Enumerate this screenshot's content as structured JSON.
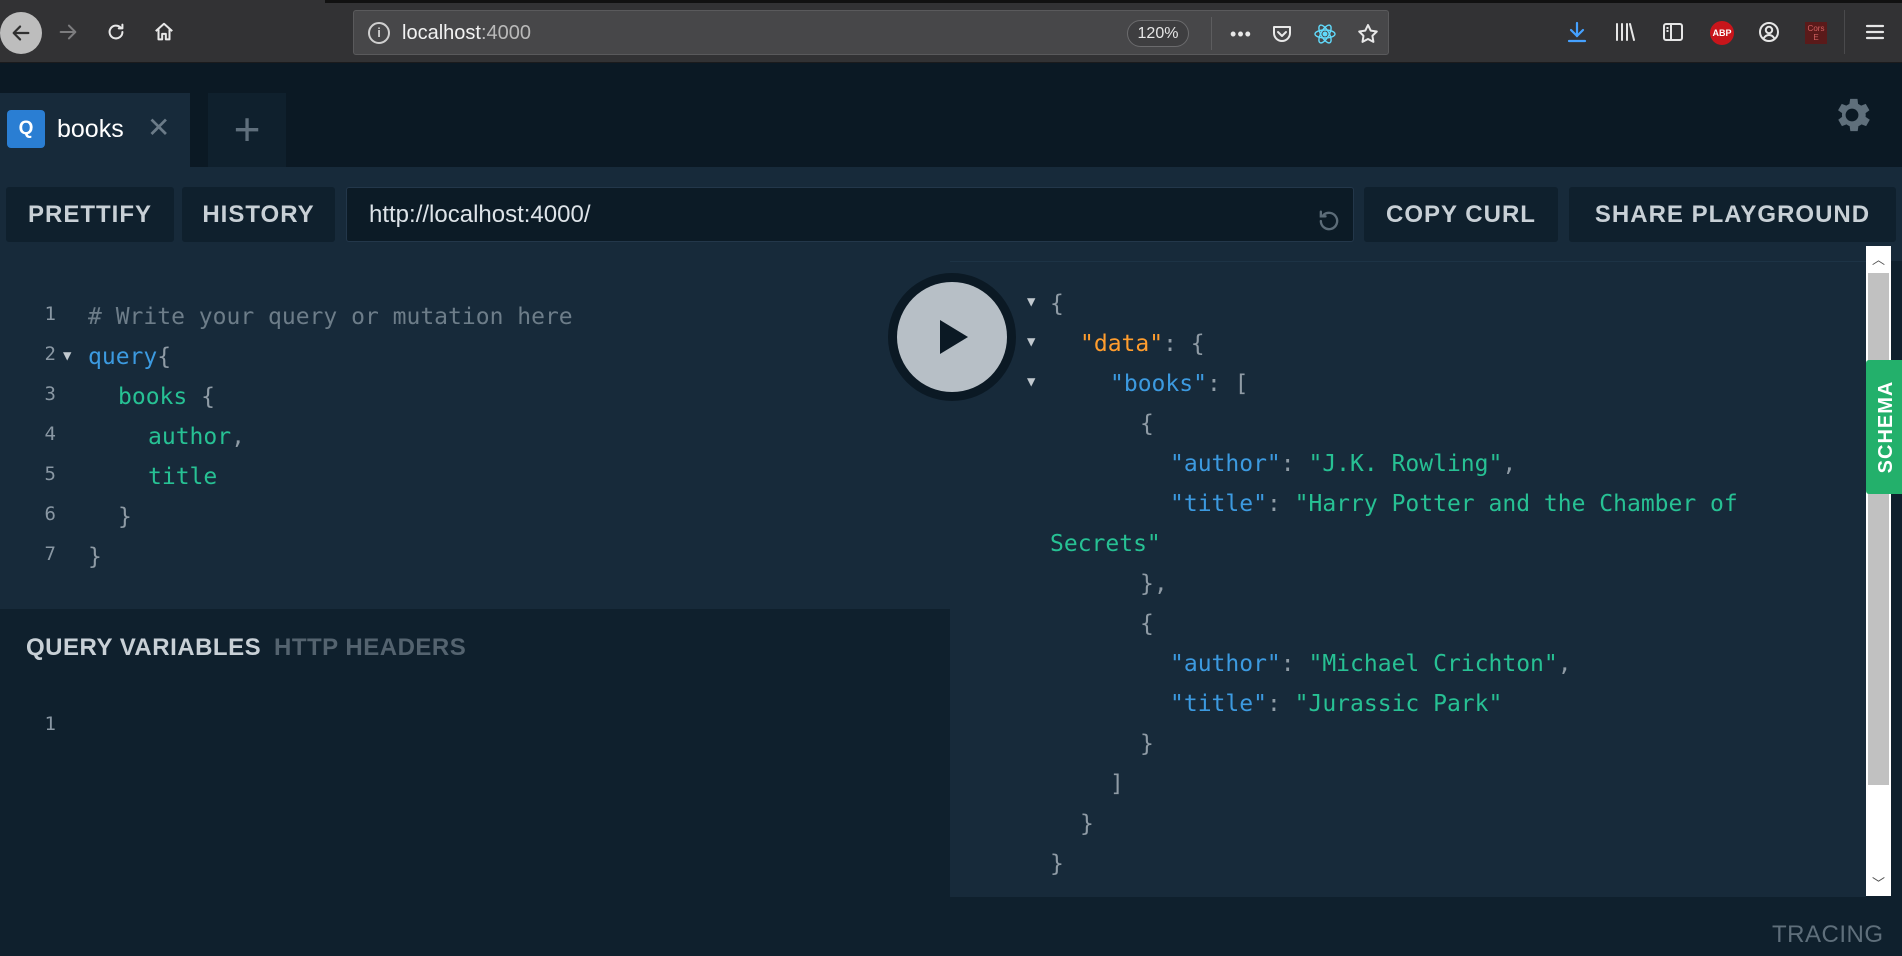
{
  "browser": {
    "url_host": "localhost",
    "url_port": ":4000",
    "zoom": "120%",
    "more_label": "•••"
  },
  "tabs": {
    "active": {
      "badge": "Q",
      "label": "books",
      "close": "✕"
    },
    "add_label": "+"
  },
  "toolbar": {
    "prettify": "PRETTIFY",
    "history": "HISTORY",
    "endpoint": "http://localhost:4000/",
    "copy_curl": "COPY CURL",
    "share": "SHARE PLAYGROUND"
  },
  "query_editor": {
    "line_numbers": [
      "1",
      "2",
      "3",
      "4",
      "5",
      "6",
      "7"
    ],
    "comment": "# Write your query or mutation here",
    "keyword": "query",
    "open_brace": "{",
    "field_books": "books",
    "field_author": "author",
    "comma": ",",
    "field_title": "title",
    "close_brace": "}"
  },
  "variables_panel": {
    "tab_variables": "QUERY VARIABLES",
    "tab_headers": "HTTP HEADERS",
    "line_number": "1"
  },
  "result": {
    "open_brace": "{",
    "data_key": "\"data\"",
    "colon_brace": ": {",
    "books_key": "\"books\"",
    "colon_bracket": ": [",
    "obj_open": "{",
    "author_key": "\"author\"",
    "title_key": "\"title\"",
    "colon": ": ",
    "comma": ",",
    "book1_author": "\"J.K. Rowling\"",
    "book1_title_part1": "\"Harry Potter and the Chamber of",
    "book1_title_part2": "Secrets\"",
    "obj_close_comma": "},",
    "book2_author": "\"Michael Crichton\"",
    "book2_title": "\"Jurassic Park\"",
    "obj_close": "}",
    "arr_close": "]",
    "data_close": "}",
    "root_close": "}"
  },
  "side": {
    "schema": "SCHEMA",
    "tracing": "TRACING"
  }
}
